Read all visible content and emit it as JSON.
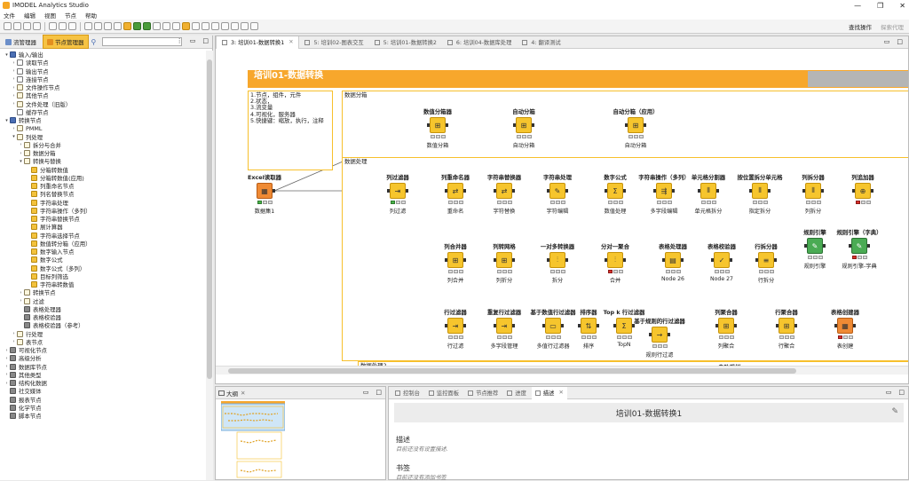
{
  "app": {
    "title": "IMODEL Analytics Studio"
  },
  "menu": [
    "文件",
    "编辑",
    "视图",
    "节点",
    "帮助"
  ],
  "toolbar_right": {
    "find": "查找操作",
    "explore": "探索代理"
  },
  "left_panel": {
    "tabs": [
      {
        "label": "流管理器"
      },
      {
        "label": "节点管理器"
      }
    ],
    "search_placeholder": ""
  },
  "tree": [
    {
      "label": "输入/输出",
      "level": 0,
      "arrow": "v",
      "icon": "io"
    },
    {
      "label": "读取节点",
      "level": 1,
      "arrow": ">",
      "icon": "file"
    },
    {
      "label": "输出节点",
      "level": 1,
      "arrow": ">",
      "icon": "file"
    },
    {
      "label": "连接节点",
      "level": 1,
      "arrow": ">",
      "icon": "file"
    },
    {
      "label": "文件操作节点",
      "level": 1,
      "arrow": ">",
      "icon": "folder"
    },
    {
      "label": "其他节点",
      "level": 1,
      "arrow": ">",
      "icon": "folder"
    },
    {
      "label": "文件处理（旧版）",
      "level": 1,
      "arrow": ">",
      "icon": "folder"
    },
    {
      "label": "缓存节点",
      "level": 1,
      "arrow": "",
      "icon": "file"
    },
    {
      "label": "转换节点",
      "level": 0,
      "arrow": "v",
      "icon": "tool"
    },
    {
      "label": "PMML",
      "level": 1,
      "arrow": ">",
      "icon": "folder"
    },
    {
      "label": "列处理",
      "level": 1,
      "arrow": "v",
      "icon": "folder"
    },
    {
      "label": "拆分与合并",
      "level": 2,
      "arrow": ">",
      "icon": "folder"
    },
    {
      "label": "数据分箱",
      "level": 2,
      "arrow": ">",
      "icon": "folder"
    },
    {
      "label": "转换与替换",
      "level": 2,
      "arrow": "v",
      "icon": "folder"
    },
    {
      "label": "分箱转数值",
      "level": 3,
      "arrow": "",
      "icon": "y"
    },
    {
      "label": "分箱转数值(应用)",
      "level": 3,
      "arrow": "",
      "icon": "y"
    },
    {
      "label": "列重命名节点",
      "level": 3,
      "arrow": "",
      "icon": "y"
    },
    {
      "label": "列名替换节点",
      "level": 3,
      "arrow": "",
      "icon": "y"
    },
    {
      "label": "字符串处理",
      "level": 3,
      "arrow": "",
      "icon": "y"
    },
    {
      "label": "字符串操作（多列）",
      "level": 3,
      "arrow": "",
      "icon": "y"
    },
    {
      "label": "字符串替换节点",
      "level": 3,
      "arrow": "",
      "icon": "y"
    },
    {
      "label": "展计算器",
      "level": 3,
      "arrow": "",
      "icon": "y"
    },
    {
      "label": "字符串选择节点",
      "level": 3,
      "arrow": "",
      "icon": "y"
    },
    {
      "label": "数值转分箱（应用）",
      "level": 3,
      "arrow": "",
      "icon": "y"
    },
    {
      "label": "数字输入节点",
      "level": 3,
      "arrow": "",
      "icon": "y"
    },
    {
      "label": "数字公式",
      "level": 3,
      "arrow": "",
      "icon": "y"
    },
    {
      "label": "数字公式（多列）",
      "level": 3,
      "arrow": "",
      "icon": "y"
    },
    {
      "label": "目标列筛选",
      "level": 3,
      "arrow": "",
      "icon": "y"
    },
    {
      "label": "字符串转数值",
      "level": 3,
      "arrow": "",
      "icon": "y"
    },
    {
      "label": "转换节点",
      "level": 2,
      "arrow": ">",
      "icon": "folder"
    },
    {
      "label": "过滤",
      "level": 2,
      "arrow": ">",
      "icon": "folder"
    },
    {
      "label": "表格处理器",
      "level": 2,
      "arrow": "",
      "icon": "gr"
    },
    {
      "label": "表格校验器",
      "level": 2,
      "arrow": "",
      "icon": "gr"
    },
    {
      "label": "表格校验器（参考）",
      "level": 2,
      "arrow": "",
      "icon": "gr"
    },
    {
      "label": "行处理",
      "level": 1,
      "arrow": ">",
      "icon": "folder"
    },
    {
      "label": "表节点",
      "level": 1,
      "arrow": ">",
      "icon": "folder"
    },
    {
      "label": "可视化节点",
      "level": 0,
      "arrow": ">",
      "icon": "gr"
    },
    {
      "label": "高级分析",
      "level": 0,
      "arrow": ">",
      "icon": "gr"
    },
    {
      "label": "数据库节点",
      "level": 0,
      "arrow": ">",
      "icon": "gr"
    },
    {
      "label": "其他类型",
      "level": 0,
      "arrow": ">",
      "icon": "gr"
    },
    {
      "label": "结构化数据",
      "level": 0,
      "arrow": ">",
      "icon": "gr"
    },
    {
      "label": "社交媒体",
      "level": 0,
      "arrow": "",
      "icon": "gr"
    },
    {
      "label": "报表节点",
      "level": 0,
      "arrow": "",
      "icon": "gr"
    },
    {
      "label": "化学节点",
      "level": 0,
      "arrow": "",
      "icon": "gr"
    },
    {
      "label": "脚本节点",
      "level": 0,
      "arrow": "",
      "icon": "gr"
    }
  ],
  "editor_tabs": [
    {
      "label": "3: 培训01-数据转换1",
      "active": true
    },
    {
      "label": "5: 培训02-图表交互",
      "active": false
    },
    {
      "label": "5: 培训01-数据转换2",
      "active": false
    },
    {
      "label": "6: 培训04-数据库处理",
      "active": false
    },
    {
      "label": "4: 翻译测试",
      "active": false
    }
  ],
  "annotations": {
    "banner": "培训01-数据转换",
    "notes": "1.节点，组件，元件\n2.状态，\n3.流变量\n4.可视化，服务器\n5.快捷键：缩放，执行，注释",
    "binning": "数据分箱",
    "processing": "数据处理",
    "processing2": "数据处理2",
    "auto_sampling": "自助采样"
  },
  "nodes": [
    {
      "title": "数值分箱器",
      "label": "数值分箱",
      "status": "y"
    },
    {
      "title": "自动分箱",
      "label": "自动分箱",
      "status": "y"
    },
    {
      "title": "自动分箱（应用）",
      "label": "自动分箱",
      "status": "y"
    },
    {
      "title": "Excel读取器",
      "label": "数据集1",
      "status": "g"
    },
    {
      "title": "列过滤器",
      "label": "列过滤",
      "status": "g"
    },
    {
      "title": "列重命名器",
      "label": "重命名",
      "status": "y"
    },
    {
      "title": "字符串替换器",
      "label": "字符替换",
      "status": "y"
    },
    {
      "title": "字符串处理",
      "label": "字符编辑",
      "status": "y"
    },
    {
      "title": "数字公式",
      "label": "数值处理",
      "status": "y"
    },
    {
      "title": "字符串操作（多列）",
      "label": "多字段编辑",
      "status": "y"
    },
    {
      "title": "单元格分割器",
      "label": "单元格拆分",
      "status": "y"
    },
    {
      "title": "按位置拆分单元格",
      "label": "指定拆分",
      "status": "y"
    },
    {
      "title": "列拆分器",
      "label": "列拆分",
      "status": "y"
    },
    {
      "title": "列追加器",
      "label": "",
      "status": "r"
    },
    {
      "title": "列合并器",
      "label": "列合并",
      "status": "y"
    },
    {
      "title": "列转网格",
      "label": "列折分",
      "status": "y"
    },
    {
      "title": "一对多转换器",
      "label": "拆分",
      "status": "y"
    },
    {
      "title": "分对一聚合",
      "label": "合并",
      "status": "r"
    },
    {
      "title": "表格处理器",
      "label": "Node 26",
      "status": "y"
    },
    {
      "title": "表格校验器",
      "label": "Node 27",
      "status": "y"
    },
    {
      "title": "行拆分器",
      "label": "行拆分",
      "status": "y"
    },
    {
      "title": "规则引擎",
      "label": "规则引擎",
      "status": "y"
    },
    {
      "title": "规则引擎（字典）",
      "label": "规则引擎-字典",
      "status": "r"
    },
    {
      "title": "行过滤器",
      "label": "行过滤",
      "status": "y"
    },
    {
      "title": "重复行过滤器",
      "label": "多字段管理",
      "status": "y"
    },
    {
      "title": "基于数值行过滤器",
      "label": "多值行过滤器",
      "status": "y"
    },
    {
      "title": "排序器",
      "label": "排序",
      "status": "y"
    },
    {
      "title": "Top k 行过滤器",
      "label": "TopN",
      "status": "y"
    },
    {
      "title": "基于规则的行过滤器",
      "label": "规则行过滤",
      "status": "y"
    },
    {
      "title": "列聚合器",
      "label": "列聚合",
      "status": "y"
    },
    {
      "title": "行聚合器",
      "label": "行聚合",
      "status": "y"
    },
    {
      "title": "表格创建器",
      "label": "表创建",
      "status": "r"
    }
  ],
  "bottom_left": {
    "tab": "大纲"
  },
  "bottom_right": {
    "tabs": [
      "控制台",
      "监控面板",
      "节点推荐",
      "进度",
      "描述"
    ],
    "active_tab": "描述",
    "heading": "培训01-数据转换1",
    "sections": [
      {
        "title": "描述",
        "text": "目前还没有设置描述."
      },
      {
        "title": "书签",
        "text": "目前还没有添加书签"
      }
    ]
  }
}
